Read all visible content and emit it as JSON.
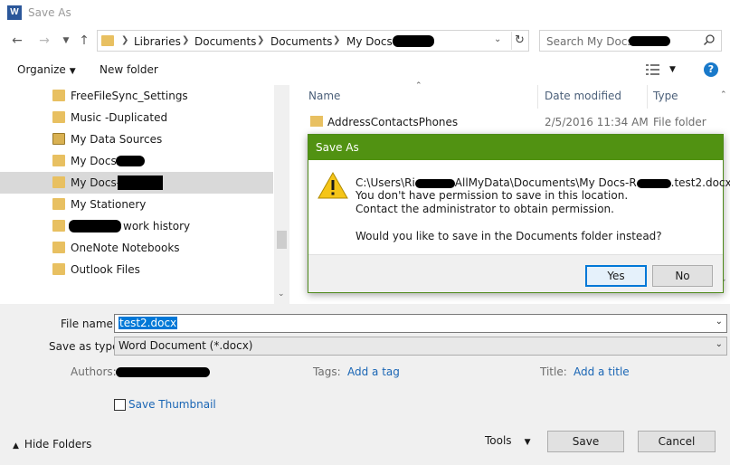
{
  "window": {
    "title": "Save As",
    "app_icon_letter": "W"
  },
  "nav": {
    "breadcrumbs": [
      "Libraries",
      "Documents",
      "Documents",
      "My Docs-"
    ],
    "search_placeholder": "Search My Docs-"
  },
  "toolbar": {
    "organize": "Organize",
    "new_folder": "New folder",
    "help": "?"
  },
  "sidebar": {
    "items": [
      {
        "label": "FreeFileSync_Settings"
      },
      {
        "label": "Music -Duplicated"
      },
      {
        "label": "My Data Sources"
      },
      {
        "label": "My Docs-"
      },
      {
        "label": "My Docs-"
      },
      {
        "label": "My Stationery"
      },
      {
        "label": "work history"
      },
      {
        "label": "OneNote Notebooks"
      },
      {
        "label": "Outlook Files"
      }
    ]
  },
  "files": {
    "columns": [
      "Name",
      "Date modified",
      "Type"
    ],
    "rows": [
      {
        "name": "AddressContactsPhones",
        "date": "2/5/2016 11:34 AM",
        "type": "File folder"
      }
    ]
  },
  "form": {
    "file_name_label": "File name:",
    "file_name_value": "test2.docx",
    "save_as_type_label": "Save as type:",
    "save_as_type_value": "Word Document (*.docx)",
    "authors_label": "Authors:",
    "tags_label": "Tags:",
    "tags_link": "Add a tag",
    "title_label": "Title:",
    "title_link": "Add a title",
    "save_thumbnail": "Save Thumbnail"
  },
  "footer": {
    "hide_folders": "Hide Folders",
    "tools": "Tools",
    "save": "Save",
    "cancel": "Cancel"
  },
  "dialog": {
    "title": "Save As",
    "path_prefix": "C:\\Users\\Ri",
    "path_middle": "AllMyData\\Documents\\My Docs-R",
    "path_suffix": ".test2.docx",
    "line2": "You don't have permission to save in this location.",
    "line3": "Contact the administrator to obtain permission.",
    "line4": "Would you like to save in the Documents folder instead?",
    "yes": "Yes",
    "no": "No"
  },
  "colors": {
    "dialog_title_bg": "#519212",
    "accent": "#0078d7",
    "link": "#1a66b5"
  }
}
